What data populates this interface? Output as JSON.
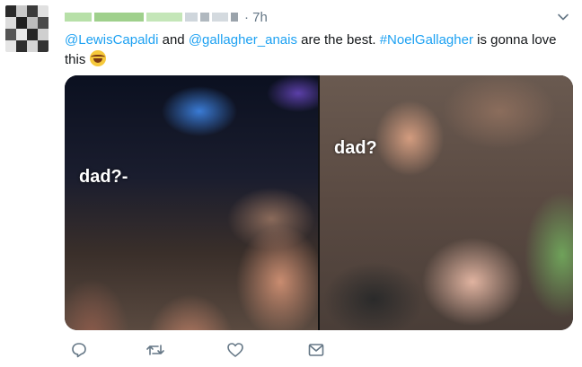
{
  "tweet": {
    "time": "· 7h",
    "text_parts": {
      "mention1": "@LewisCapaldi",
      "conj": " and ",
      "mention2": "@gallagher_anais",
      "middle": " are the best. ",
      "hashtag": "#NoelGallagher",
      "end": " is gonna love this "
    }
  },
  "media": {
    "left_caption": "dad?-",
    "right_caption": "dad?"
  },
  "icons": {
    "caret": "chevron-down-icon",
    "reply": "reply-icon",
    "retweet": "retweet-icon",
    "like": "heart-icon",
    "dm": "envelope-icon",
    "emoji": "tears-of-joy-emoji"
  },
  "colors": {
    "link": "#1da1f2",
    "muted": "#657786",
    "text": "#14171a"
  }
}
